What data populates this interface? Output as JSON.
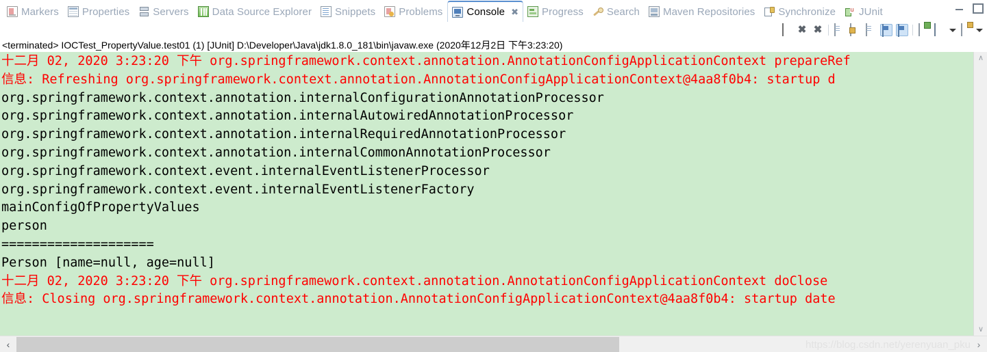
{
  "window": {
    "minimize_label": "–",
    "maximize_label": "□"
  },
  "tabs": [
    {
      "label": "Markers",
      "icon": "markers-icon",
      "active": false
    },
    {
      "label": "Properties",
      "icon": "properties-icon",
      "active": false
    },
    {
      "label": "Servers",
      "icon": "servers-icon",
      "active": false
    },
    {
      "label": "Data Source Explorer",
      "icon": "datasource-icon",
      "active": false
    },
    {
      "label": "Snippets",
      "icon": "snippets-icon",
      "active": false
    },
    {
      "label": "Problems",
      "icon": "problems-icon",
      "active": false
    },
    {
      "label": "Console",
      "icon": "console-icon",
      "active": true,
      "close_label": "✖"
    },
    {
      "label": "Progress",
      "icon": "progress-icon",
      "active": false
    },
    {
      "label": "Search",
      "icon": "search-icon",
      "active": false
    },
    {
      "label": "Maven Repositories",
      "icon": "maven-icon",
      "active": false
    },
    {
      "label": "Synchronize",
      "icon": "sync-icon",
      "active": false
    },
    {
      "label": "JUnit",
      "icon": "junit-icon",
      "active": false
    }
  ],
  "toolbar": {
    "buttons": [
      {
        "name": "terminate-button",
        "icon": "stop-icon"
      },
      {
        "name": "remove-launch-button",
        "icon": "x-icon",
        "glyph": "✖"
      },
      {
        "name": "remove-all-terminated-button",
        "icon": "double-x-icon",
        "glyph": "✖"
      },
      {
        "name": "clear-console-button",
        "icon": "clear-console-icon"
      },
      {
        "name": "scroll-lock-button",
        "icon": "scroll-lock-icon"
      },
      {
        "name": "word-wrap-button",
        "icon": "word-wrap-icon"
      },
      {
        "name": "show-console-on-output-button",
        "icon": "console-out-icon",
        "selected": true
      },
      {
        "name": "show-console-on-error-button",
        "icon": "console-err-icon",
        "selected": true
      },
      {
        "name": "pin-console-button",
        "icon": "pin-console-icon"
      },
      {
        "name": "display-selected-console-button",
        "icon": "monitor-icon"
      },
      {
        "name": "display-selected-console-dropdown",
        "icon": "chevron-down-icon"
      },
      {
        "name": "open-console-button",
        "icon": "new-console-icon"
      },
      {
        "name": "open-console-dropdown",
        "icon": "chevron-down-icon"
      }
    ]
  },
  "console": {
    "header": "<terminated> IOCTest_PropertyValue.test01 (1) [JUnit] D:\\Developer\\Java\\jdk1.8.0_181\\bin\\javaw.exe (2020年12月2日 下午3:23:20)",
    "background_color": "#CDEBCD",
    "error_color": "#FF0000",
    "text_color": "#000000",
    "lines": [
      {
        "color": "red",
        "text": "十二月 02, 2020 3:23:20 下午 org.springframework.context.annotation.AnnotationConfigApplicationContext prepareRef"
      },
      {
        "color": "red",
        "text": "信息: Refreshing org.springframework.context.annotation.AnnotationConfigApplicationContext@4aa8f0b4: startup d"
      },
      {
        "color": "black",
        "text": "org.springframework.context.annotation.internalConfigurationAnnotationProcessor"
      },
      {
        "color": "black",
        "text": "org.springframework.context.annotation.internalAutowiredAnnotationProcessor"
      },
      {
        "color": "black",
        "text": "org.springframework.context.annotation.internalRequiredAnnotationProcessor"
      },
      {
        "color": "black",
        "text": "org.springframework.context.annotation.internalCommonAnnotationProcessor"
      },
      {
        "color": "black",
        "text": "org.springframework.context.event.internalEventListenerProcessor"
      },
      {
        "color": "black",
        "text": "org.springframework.context.event.internalEventListenerFactory"
      },
      {
        "color": "black",
        "text": "mainConfigOfPropertyValues"
      },
      {
        "color": "black",
        "text": "person"
      },
      {
        "color": "black",
        "text": "===================="
      },
      {
        "color": "black",
        "text": "Person [name=null, age=null]"
      },
      {
        "color": "red",
        "text": "十二月 02, 2020 3:23:20 下午 org.springframework.context.annotation.AnnotationConfigApplicationContext doClose"
      },
      {
        "color": "red",
        "text": "信息: Closing org.springframework.context.annotation.AnnotationConfigApplicationContext@4aa8f0b4: startup date"
      }
    ]
  },
  "scrollbars": {
    "vertical_up": "∧",
    "vertical_down": "∨",
    "horizontal_left": "‹",
    "horizontal_right": "›"
  },
  "watermark": "https://blog.csdn.net/yerenyuan_pku"
}
